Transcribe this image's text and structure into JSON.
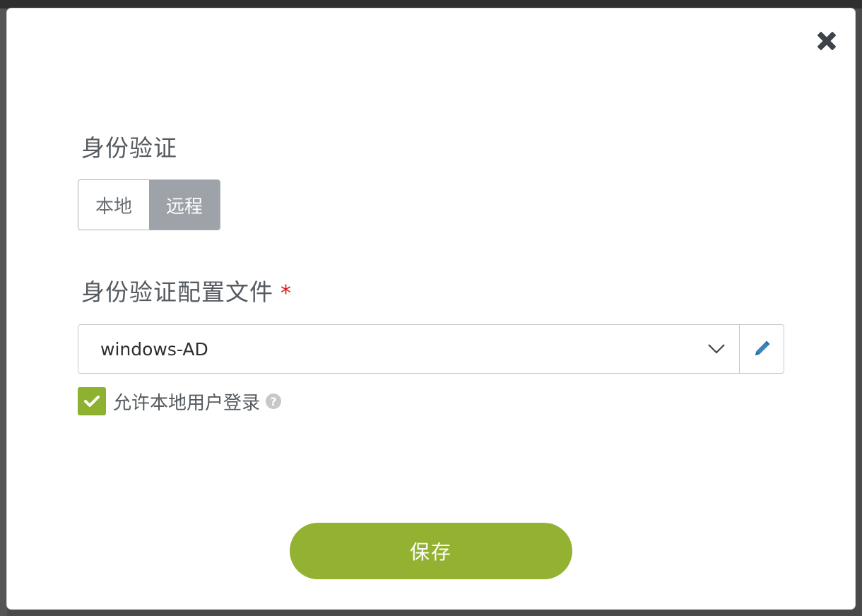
{
  "auth": {
    "title": "身份验证",
    "options": [
      {
        "label": "本地",
        "active": false
      },
      {
        "label": "远程",
        "active": true
      }
    ]
  },
  "profile": {
    "title": "身份验证配置文件",
    "required_mark": "*",
    "selected_value": "windows-AD"
  },
  "local_login": {
    "label": "允许本地用户登录",
    "checked": true,
    "help_glyph": "?"
  },
  "save_button": {
    "label": "保存"
  },
  "colors": {
    "accent_green": "#94b231",
    "toggle_active": "#9da3a8",
    "required_red": "#e01010",
    "edit_icon_blue": "#3b84b8"
  },
  "icons": {
    "close": "close-icon",
    "chevron": "chevron-down-icon",
    "edit": "pencil-icon",
    "check": "checkmark-icon",
    "help": "question-circle-icon"
  }
}
